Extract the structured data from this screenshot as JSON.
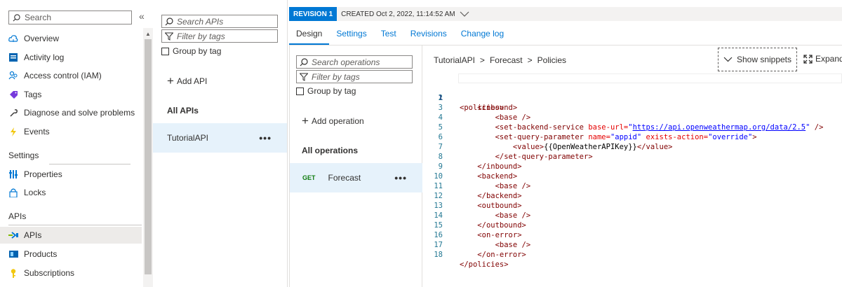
{
  "left_menu": {
    "search_placeholder": "Search",
    "collapse_glyph": "«",
    "items_top": [
      {
        "label": "Overview",
        "icon": "cloud-icon"
      },
      {
        "label": "Activity log",
        "icon": "activity-log-icon"
      },
      {
        "label": "Access control (IAM)",
        "icon": "people-icon"
      },
      {
        "label": "Tags",
        "icon": "tag-icon"
      },
      {
        "label": "Diagnose and solve problems",
        "icon": "wrench-icon"
      },
      {
        "label": "Events",
        "icon": "lightning-icon"
      }
    ],
    "settings_title": "Settings",
    "settings_items": [
      {
        "label": "Properties",
        "icon": "properties-icon"
      },
      {
        "label": "Locks",
        "icon": "lock-icon"
      }
    ],
    "apis_title": "APIs",
    "apis_items": [
      {
        "label": "APIs",
        "icon": "api-icon",
        "active": true
      },
      {
        "label": "Products",
        "icon": "products-icon"
      },
      {
        "label": "Subscriptions",
        "icon": "key-icon"
      }
    ]
  },
  "api_column": {
    "search_placeholder": "Search APIs",
    "filter_placeholder": "Filter by tags",
    "group_by_tag": "Group by tag",
    "add_api": "Add API",
    "all_apis": "All APIs",
    "apis": [
      {
        "name": "TutorialAPI",
        "more": "•••"
      }
    ]
  },
  "detail": {
    "revision_badge": "REVISION 1",
    "created": "CREATED Oct 2, 2022, 11:14:52 AM",
    "tabs": [
      "Design",
      "Settings",
      "Test",
      "Revisions",
      "Change log"
    ],
    "active_tab": "Design",
    "operations": {
      "search_placeholder": "Search operations",
      "filter_placeholder": "Filter by tags",
      "group_by_tag": "Group by tag",
      "add_operation": "Add operation",
      "all_operations": "All operations",
      "items": [
        {
          "method": "GET",
          "name": "Forecast",
          "more": "•••"
        }
      ]
    },
    "breadcrumb": [
      "TutorialAPI",
      "Forecast",
      "Policies"
    ],
    "breadcrumb_sep": ">",
    "show_snippets": "Show snippets",
    "expand": "Expand",
    "code": {
      "line_numbers": [
        "1",
        "2",
        "3",
        "4",
        "5",
        "6",
        "7",
        "8",
        "9",
        "10",
        "11",
        "12",
        "13",
        "14",
        "15",
        "16",
        "17",
        "18"
      ],
      "tag_policies_open": "<policies>",
      "tag_inbound_open": "<inbound>",
      "tag_base": "<base />",
      "tag_sbs": "<set-backend-service",
      "attr_base_url": "base-url=",
      "val_base_url_q1": "\"",
      "val_base_url": "https://api.openweathermap.org/data/2.5",
      "val_base_url_q2": "\"",
      "tag_close_self": "/>",
      "tag_sqp": "<set-query-parameter",
      "attr_name": "name=",
      "val_name": "\"appid\"",
      "attr_exists": "exists-action=",
      "val_exists": "\"override\"",
      "tag_gt": ">",
      "tag_value_open": "<value>",
      "value_text": "{{OpenWeatherAPIKey}}",
      "tag_value_close": "</value>",
      "tag_sqp_close": "</set-query-parameter>",
      "tag_inbound_close": "</inbound>",
      "tag_backend_open": "<backend>",
      "tag_backend_close": "</backend>",
      "tag_outbound_open": "<outbound>",
      "tag_outbound_close": "</outbound>",
      "tag_onerror_open": "<on-error>",
      "tag_onerror_close": "</on-error>",
      "tag_policies_close": "</policies>"
    }
  },
  "colors": {
    "accent": "#0078d4",
    "selected_row": "#e6f2fb",
    "get_method": "#107c10"
  }
}
